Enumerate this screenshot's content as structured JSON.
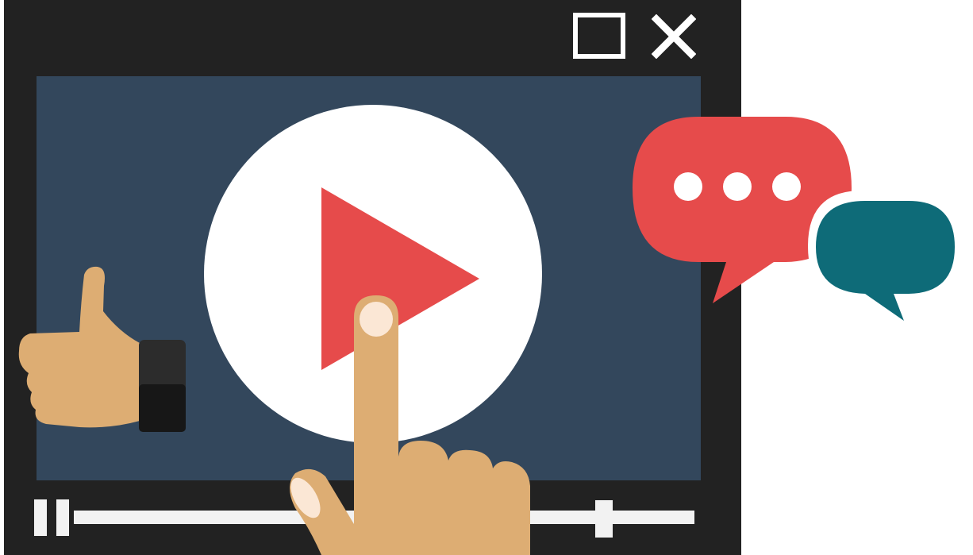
{
  "icons": {
    "maximize": "maximize-icon",
    "close": "close-icon",
    "play": "play-icon",
    "pause": "pause-icon",
    "thumbs_up": "thumbs-up-icon",
    "pointing_hand": "pointing-hand-icon",
    "chat_red": "speech-bubble-typing-icon",
    "chat_teal": "speech-bubble-icon"
  },
  "player": {
    "progress": 0.84,
    "state": "paused"
  },
  "colors": {
    "window": "#222222",
    "screen": "#33475c",
    "play_button": "#ffffff",
    "play_triangle": "#e64b4b",
    "chat_red": "#e64b4b",
    "chat_teal": "#0e6b78",
    "skin": "#ddad73",
    "control": "#f2f2f2"
  }
}
